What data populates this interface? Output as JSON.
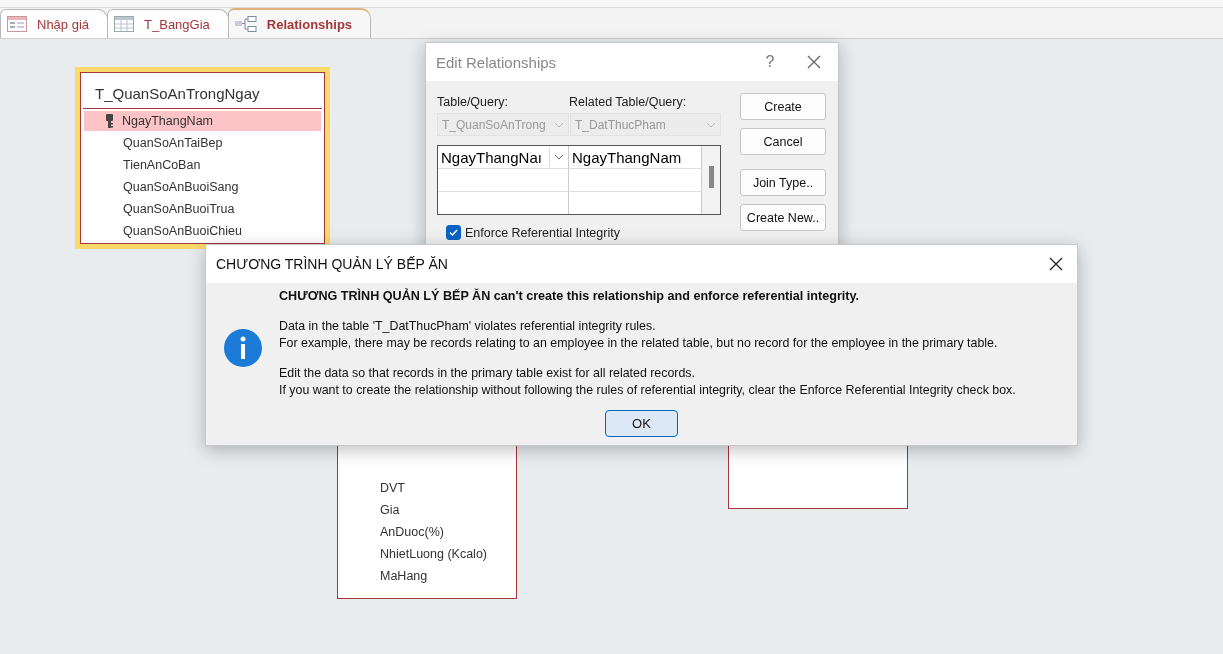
{
  "tabs": [
    {
      "label": "Nhập giá",
      "kind": "form",
      "selected": false
    },
    {
      "label": "T_BangGia",
      "kind": "table",
      "selected": false
    },
    {
      "label": "Relationships",
      "kind": "relationships",
      "selected": true
    }
  ],
  "tables": [
    {
      "title": "T_QuanSoAnTrongNgay",
      "highlighted": true,
      "fields": [
        {
          "name": "NgayThangNam",
          "primary_key": true,
          "selected": true
        },
        {
          "name": "QuanSoAnTaiBep",
          "primary_key": false,
          "selected": false
        },
        {
          "name": "TienAnCoBan",
          "primary_key": false,
          "selected": false
        },
        {
          "name": "QuanSoAnBuoiSang",
          "primary_key": false,
          "selected": false
        },
        {
          "name": "QuanSoAnBuoiTrua",
          "primary_key": false,
          "selected": false
        },
        {
          "name": "QuanSoAnBuoiChieu",
          "primary_key": false,
          "selected": false
        }
      ]
    },
    {
      "highlighted": false,
      "fields": [
        {
          "name": "DVT",
          "primary_key": false,
          "selected": false
        },
        {
          "name": "Gia",
          "primary_key": false,
          "selected": false
        },
        {
          "name": "AnDuoc(%)",
          "primary_key": false,
          "selected": false
        },
        {
          "name": "NhietLuong (Kcalo)",
          "primary_key": false,
          "selected": false
        },
        {
          "name": "MaHang",
          "primary_key": false,
          "selected": false
        }
      ]
    },
    {
      "highlighted": false
    }
  ],
  "edit_dialog": {
    "title": "Edit Relationships",
    "help": "?",
    "table_label": "Table/Query:",
    "related_label": "Related Table/Query:",
    "table_value": "T_QuanSoAnTrong",
    "related_value": "T_DatThucPham",
    "join_rows": [
      {
        "left": "NgayThangNaı",
        "right": "NgayThangNam"
      }
    ],
    "enforce": {
      "label": "Enforce Referential Integrity",
      "checked": true
    },
    "buttons": [
      "Create",
      "Cancel",
      "Join Type..",
      "Create New.."
    ]
  },
  "alert": {
    "title": "CHƯƠNG TRÌNH QUẢN LÝ BẾP ĂN",
    "heading": "CHƯƠNG TRÌNH QUẢN LÝ BẾP ĂN can't create this relationship and enforce referential integrity.",
    "paragraphs": [
      [
        "Data in the table 'T_DatThucPham' violates referential integrity rules.",
        "For example, there may be records relating to an employee in the related table, but no record for the employee in the primary table."
      ],
      [
        "Edit the data so that records in the primary table exist for all related records.",
        "If you want to create the relationship without following the rules of referential integrity, clear the Enforce Referential Integrity check box."
      ]
    ],
    "button": "OK"
  }
}
